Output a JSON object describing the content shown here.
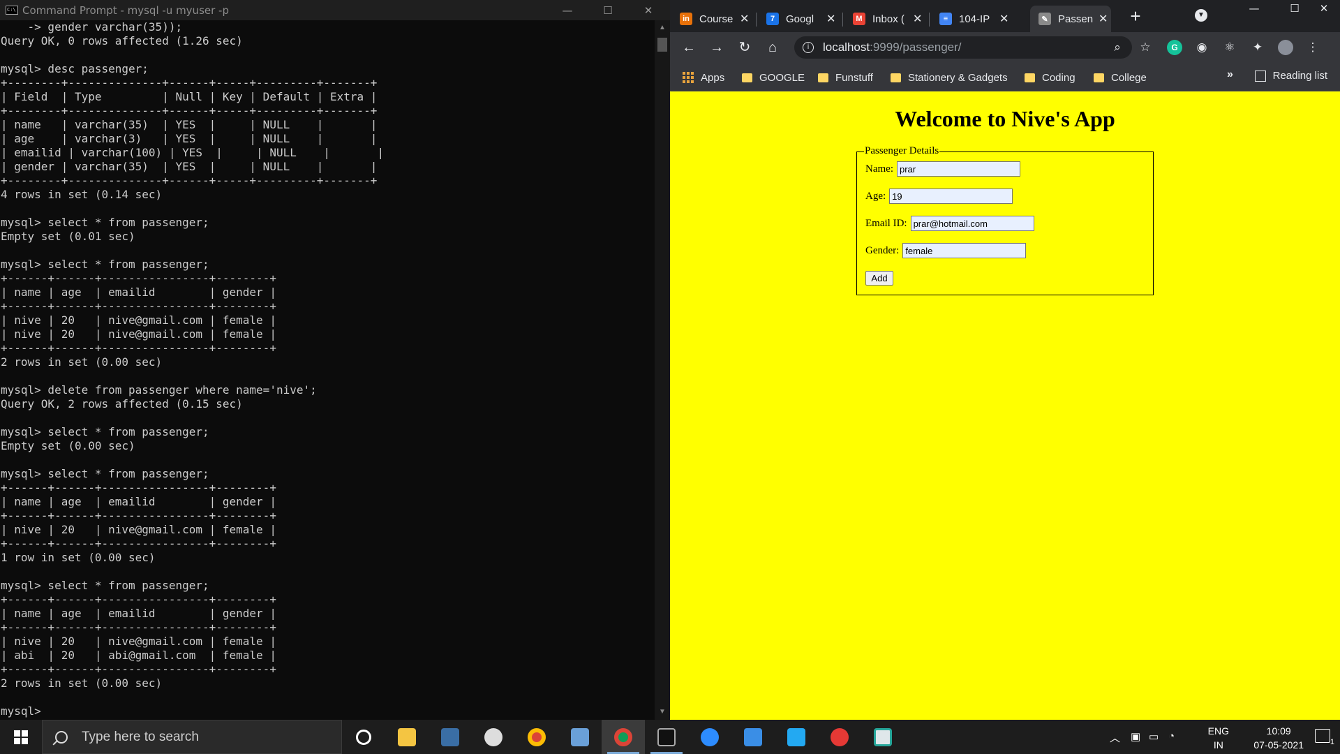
{
  "cmd": {
    "title": "Command Prompt - mysql  -u myuser -p",
    "lines": [
      "    -> gender varchar(35));",
      "Query OK, 0 rows affected (1.26 sec)",
      "",
      "mysql> desc passenger;",
      "+--------+--------------+------+-----+---------+-------+",
      "| Field  | Type         | Null | Key | Default | Extra |",
      "+--------+--------------+------+-----+---------+-------+",
      "| name   | varchar(35)  | YES  |     | NULL    |       |",
      "| age    | varchar(3)   | YES  |     | NULL    |       |",
      "| emailid | varchar(100) | YES  |     | NULL    |       |",
      "| gender | varchar(35)  | YES  |     | NULL    |       |",
      "+--------+--------------+------+-----+---------+-------+",
      "4 rows in set (0.14 sec)",
      "",
      "mysql> select * from passenger;",
      "Empty set (0.01 sec)",
      "",
      "mysql> select * from passenger;",
      "+------+------+----------------+--------+",
      "| name | age  | emailid        | gender |",
      "+------+------+----------------+--------+",
      "| nive | 20   | nive@gmail.com | female |",
      "| nive | 20   | nive@gmail.com | female |",
      "+------+------+----------------+--------+",
      "2 rows in set (0.00 sec)",
      "",
      "mysql> delete from passenger where name='nive';",
      "Query OK, 2 rows affected (0.15 sec)",
      "",
      "mysql> select * from passenger;",
      "Empty set (0.00 sec)",
      "",
      "mysql> select * from passenger;",
      "+------+------+----------------+--------+",
      "| name | age  | emailid        | gender |",
      "+------+------+----------------+--------+",
      "| nive | 20   | nive@gmail.com | female |",
      "+------+------+----------------+--------+",
      "1 row in set (0.00 sec)",
      "",
      "mysql> select * from passenger;",
      "+------+------+----------------+--------+",
      "| name | age  | emailid        | gender |",
      "+------+------+----------------+--------+",
      "| nive | 20   | nive@gmail.com | female |",
      "| abi  | 20   | abi@gmail.com  | female |",
      "+------+------+----------------+--------+",
      "2 rows in set (0.00 sec)",
      "",
      "mysql> "
    ]
  },
  "browser": {
    "tabs": [
      {
        "title": "Course",
        "favicon_text": "in",
        "favicon_color": "#e8710a",
        "favicon": "coursera-icon"
      },
      {
        "title": "Googl",
        "favicon_text": "7",
        "favicon_color": "#1a73e8",
        "favicon": "google-calendar-icon"
      },
      {
        "title": "Inbox (",
        "favicon_text": "M",
        "favicon_color": "#ea4335",
        "favicon": "gmail-icon"
      },
      {
        "title": "104-IP",
        "favicon_text": "≡",
        "favicon_color": "#4285f4",
        "favicon": "google-docs-icon"
      },
      {
        "title": "Passen",
        "favicon_text": "✎",
        "favicon_color": "#8a8a8a",
        "favicon": "page-icon"
      }
    ],
    "url_host": "localhost",
    "url_path": ":9999/passenger/",
    "bookmarks": {
      "apps_label": "Apps",
      "folders": [
        "GOOGLE",
        "Funstuff",
        "Stationery & Gadgets",
        "Coding",
        "College"
      ],
      "more": "»",
      "reading_list": "Reading list"
    },
    "page": {
      "heading": "Welcome to Nive's App",
      "legend": "Passenger Details",
      "fields": {
        "name_label": "Name:",
        "name_value": "prar",
        "age_label": "Age:",
        "age_value": "19",
        "email_label": "Email ID:",
        "email_value": "prar@hotmail.com",
        "gender_label": "Gender:",
        "gender_value": "female"
      },
      "add_label": "Add",
      "background": "#ffff00"
    }
  },
  "taskbar": {
    "search_placeholder": "Type here to search",
    "lang_line1": "ENG",
    "lang_line2": "IN",
    "time": "10:09",
    "date": "07-05-2021",
    "notification_count": "1"
  }
}
